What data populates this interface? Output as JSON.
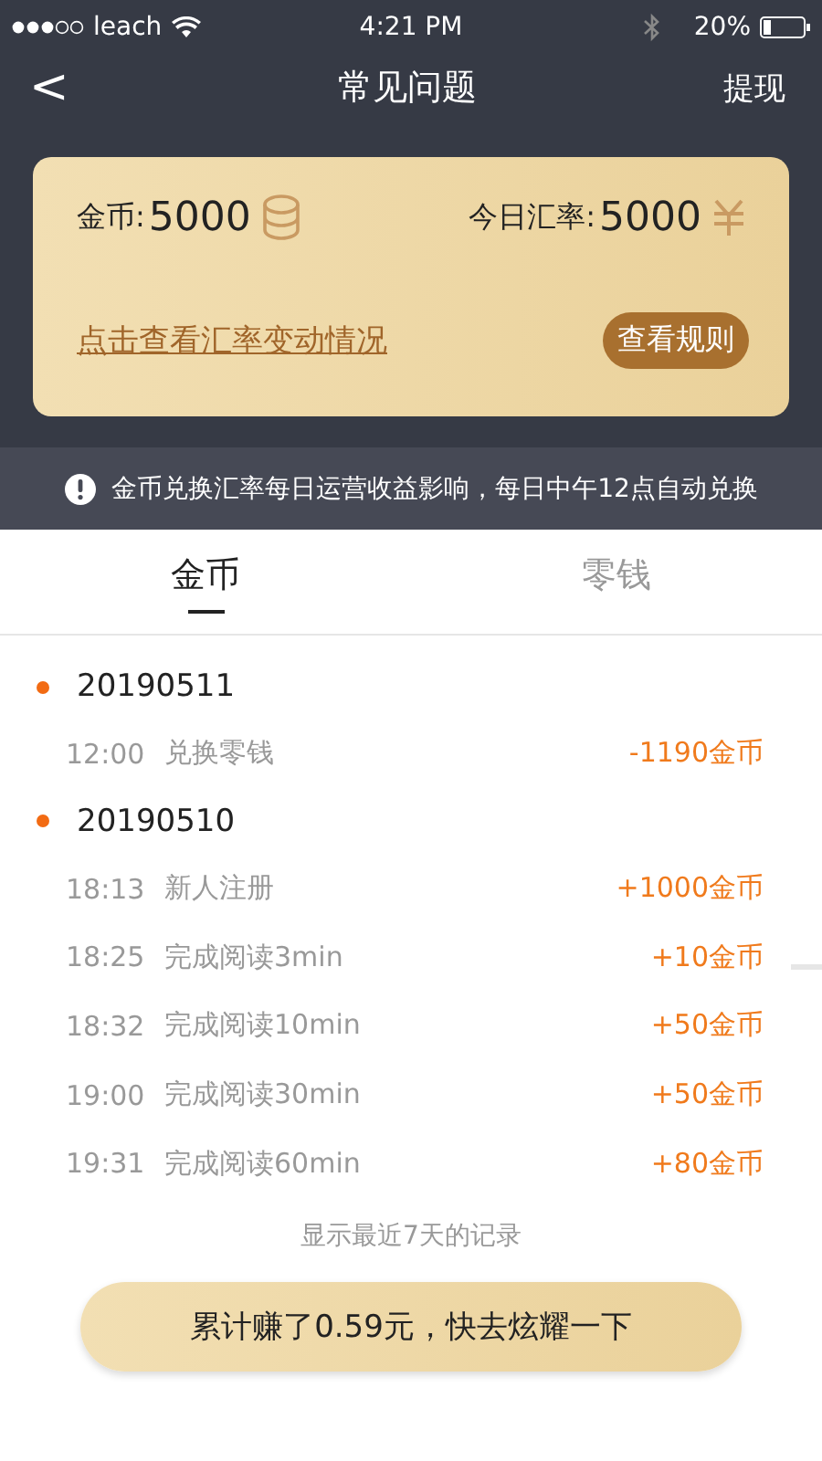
{
  "status_bar": {
    "carrier": "leach",
    "time": "4:21 PM",
    "battery": "20%"
  },
  "nav": {
    "back": "<",
    "title": "常见问题",
    "action": "提现"
  },
  "card": {
    "coins_label": "金币:",
    "coins": "5000",
    "rate_label": "今日汇率:",
    "rate": "5000",
    "link": "点击查看汇率变动情况",
    "rules_button": "查看规则"
  },
  "notice": "金币兑换汇率每日运营收益影响，每日中午12点自动兑换",
  "tabs": [
    {
      "label": "金币",
      "selected": true
    },
    {
      "label": "零钱",
      "selected": false
    }
  ],
  "groups": [
    {
      "date": "20190511",
      "items": [
        {
          "time": "12:00",
          "desc": "兑换零钱",
          "amount": "-1190金币"
        }
      ]
    },
    {
      "date": "20190510",
      "items": [
        {
          "time": "18:13",
          "desc": "新人注册",
          "amount": "+1000金币"
        },
        {
          "time": "18:25",
          "desc": "完成阅读3min",
          "amount": "+10金币"
        },
        {
          "time": "18:32",
          "desc": "完成阅读10min",
          "amount": "+50金币"
        },
        {
          "time": "19:00",
          "desc": "完成阅读30min",
          "amount": "+50金币"
        },
        {
          "time": "19:31",
          "desc": "完成阅读60min",
          "amount": "+80金币"
        }
      ]
    }
  ],
  "footer_note": "显示最近7天的记录",
  "share_button": "累计赚了0.59元，快去炫耀一下"
}
